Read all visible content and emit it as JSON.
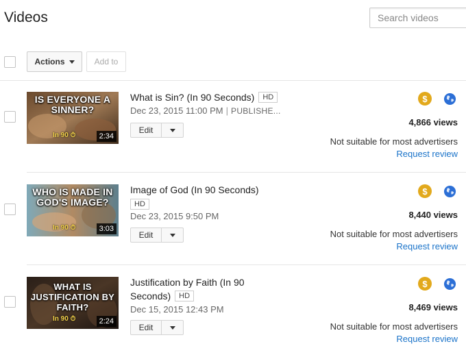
{
  "header": {
    "title": "Videos",
    "search_placeholder": "Search videos"
  },
  "toolbar": {
    "actions_label": "Actions",
    "add_to_label": "Add to"
  },
  "colors": {
    "monetization": "#e2a91c",
    "globe": "#2c6fd6",
    "link": "#1a73c9"
  },
  "videos": [
    {
      "title": "What is Sin? (In 90 Seconds)",
      "hd": "HD",
      "date": "Dec 23, 2015 11:00 PM",
      "status": "PUBLISHE...",
      "thumb_text": "IS EVERYONE A SINNER?",
      "thumb_badge": "In 90 ⏱",
      "duration": "2:34",
      "edit_label": "Edit",
      "views": "4,866 views",
      "ad_status": "Not suitable for most advertisers",
      "review_label": "Request review",
      "icons": [
        "monetization-icon",
        "globe-icon"
      ]
    },
    {
      "title": "Image of God (In 90 Seconds)",
      "hd": "HD",
      "date": "Dec 23, 2015 9:50 PM",
      "thumb_text": "WHO IS MADE IN GOD'S IMAGE?",
      "thumb_badge": "In 90 ⏱",
      "duration": "3:03",
      "edit_label": "Edit",
      "views": "8,440 views",
      "ad_status": "Not suitable for most advertisers",
      "review_label": "Request review",
      "icons": [
        "monetization-icon",
        "globe-icon"
      ]
    },
    {
      "title": "Justification by Faith (In 90 Seconds)",
      "title_line1": "Justification by Faith (In 90",
      "title_line2": "Seconds)",
      "hd": "HD",
      "date": "Dec 15, 2015 12:43 PM",
      "thumb_text": "WHAT IS JUSTIFICATION BY FAITH?",
      "thumb_badge": "In 90 ⏱",
      "duration": "2:24",
      "edit_label": "Edit",
      "views": "8,469 views",
      "ad_status": "Not suitable for most advertisers",
      "review_label": "Request review",
      "icons": [
        "monetization-icon",
        "globe-icon"
      ]
    }
  ]
}
